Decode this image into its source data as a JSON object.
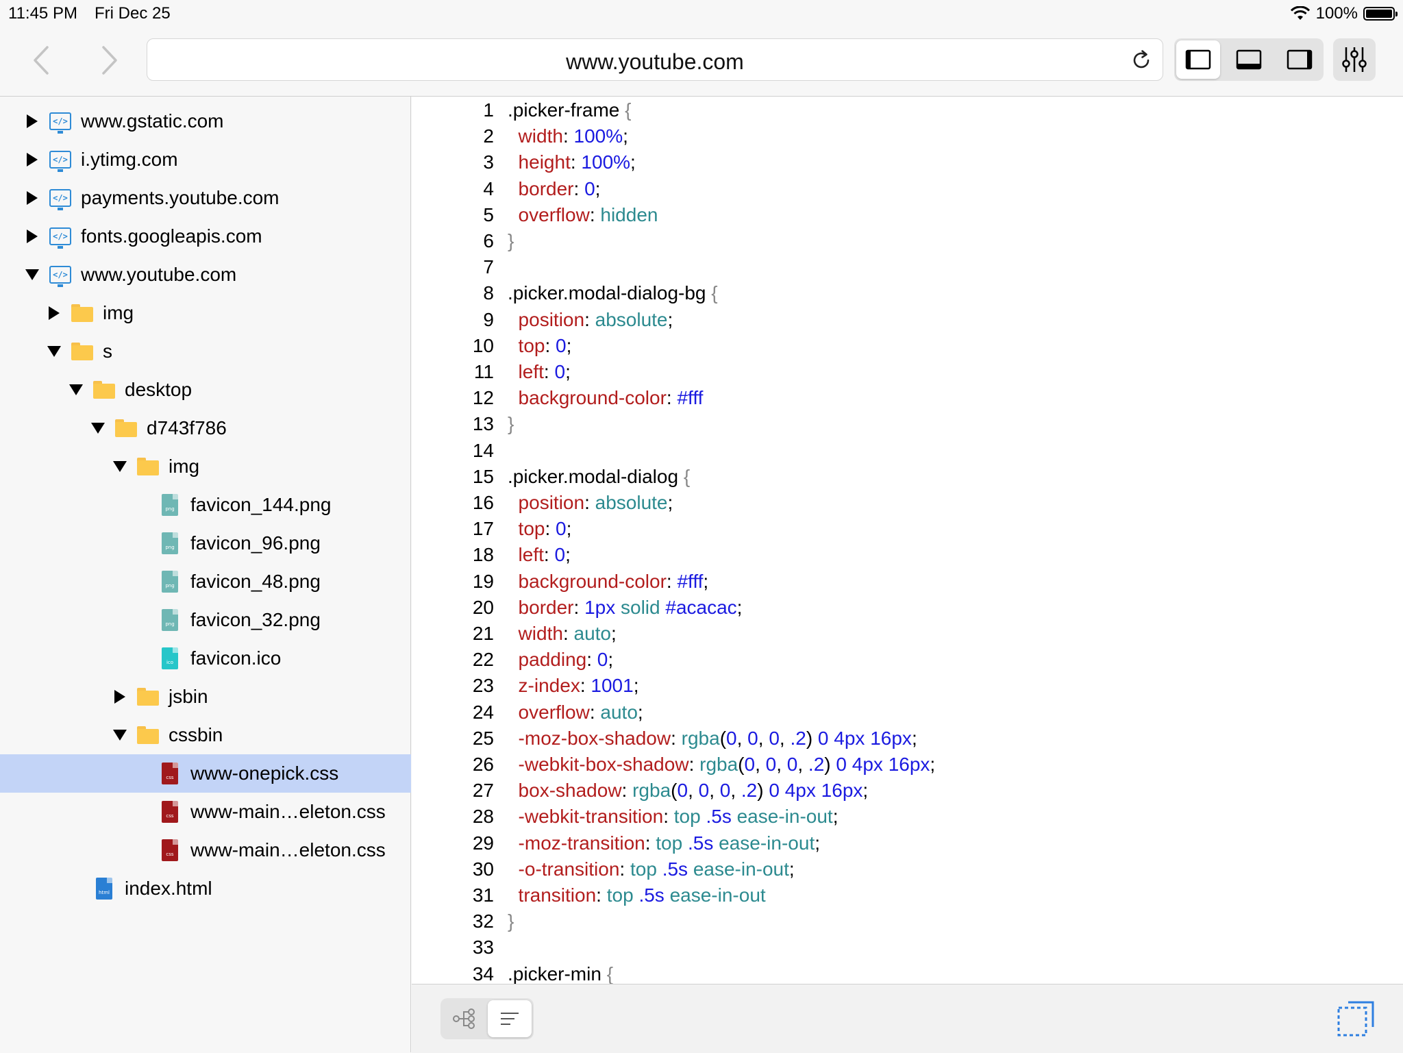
{
  "status": {
    "time": "11:45 PM",
    "date": "Fri Dec 25",
    "battery": "100%",
    "battery_level": 1.0
  },
  "toolbar": {
    "url": "www.youtube.com",
    "icons": {
      "back": "chevron-left-icon",
      "forward": "chevron-right-icon",
      "reload": "reload-icon",
      "settings": "sliders-icon"
    }
  },
  "tree": [
    {
      "label": "www.gstatic.com",
      "type": "domain",
      "depth": 0,
      "state": "collapsed"
    },
    {
      "label": "i.ytimg.com",
      "type": "domain",
      "depth": 0,
      "state": "collapsed"
    },
    {
      "label": "payments.youtube.com",
      "type": "domain",
      "depth": 0,
      "state": "collapsed"
    },
    {
      "label": "fonts.googleapis.com",
      "type": "domain",
      "depth": 0,
      "state": "collapsed"
    },
    {
      "label": "www.youtube.com",
      "type": "domain",
      "depth": 0,
      "state": "expanded"
    },
    {
      "label": "img",
      "type": "folder",
      "depth": 1,
      "state": "collapsed"
    },
    {
      "label": "s",
      "type": "folder",
      "depth": 1,
      "state": "expanded"
    },
    {
      "label": "desktop",
      "type": "folder",
      "depth": 2,
      "state": "expanded"
    },
    {
      "label": "d743f786",
      "type": "folder",
      "depth": 3,
      "state": "expanded"
    },
    {
      "label": "img",
      "type": "folder",
      "depth": 4,
      "state": "expanded"
    },
    {
      "label": "favicon_144.png",
      "type": "png",
      "depth": 5,
      "state": "none"
    },
    {
      "label": "favicon_96.png",
      "type": "png",
      "depth": 5,
      "state": "none"
    },
    {
      "label": "favicon_48.png",
      "type": "png",
      "depth": 5,
      "state": "none"
    },
    {
      "label": "favicon_32.png",
      "type": "png",
      "depth": 5,
      "state": "none"
    },
    {
      "label": "favicon.ico",
      "type": "ico",
      "depth": 5,
      "state": "none"
    },
    {
      "label": "jsbin",
      "type": "folder",
      "depth": 4,
      "state": "collapsed"
    },
    {
      "label": "cssbin",
      "type": "folder",
      "depth": 4,
      "state": "expanded"
    },
    {
      "label": "www-onepick.css",
      "type": "css",
      "depth": 5,
      "state": "none",
      "selected": true
    },
    {
      "label": "www-main…eleton.css",
      "type": "css",
      "depth": 5,
      "state": "none"
    },
    {
      "label": "www-main…eleton.css",
      "type": "css",
      "depth": 5,
      "state": "none"
    },
    {
      "label": "index.html",
      "type": "html",
      "depth": 2,
      "state": "none"
    }
  ],
  "file_icon_labels": {
    "png": "png",
    "ico": "ico",
    "css": "css",
    "html": "html"
  },
  "colors": {
    "png": "#6fb7b4",
    "ico": "#27c6c9",
    "css": "#a0191c",
    "html": "#2a7fd4",
    "selected_row": "#c3d4f7",
    "property": "#b21d1d",
    "number": "#1a1ae0",
    "keyword": "#2c8a8f"
  },
  "code": [
    [
      [
        "sel",
        ".picker-frame "
      ],
      [
        "brace",
        "{"
      ]
    ],
    [
      [
        "prop",
        "  width"
      ],
      [
        "pn",
        ": "
      ],
      [
        "num",
        "100%"
      ],
      [
        "pn",
        ";"
      ]
    ],
    [
      [
        "prop",
        "  height"
      ],
      [
        "pn",
        ": "
      ],
      [
        "num",
        "100%"
      ],
      [
        "pn",
        ";"
      ]
    ],
    [
      [
        "prop",
        "  border"
      ],
      [
        "pn",
        ": "
      ],
      [
        "num",
        "0"
      ],
      [
        "pn",
        ";"
      ]
    ],
    [
      [
        "prop",
        "  overflow"
      ],
      [
        "pn",
        ": "
      ],
      [
        "kw",
        "hidden"
      ]
    ],
    [
      [
        "brace",
        "}"
      ]
    ],
    [],
    [
      [
        "sel",
        ".picker.modal-dialog-bg "
      ],
      [
        "brace",
        "{"
      ]
    ],
    [
      [
        "prop",
        "  position"
      ],
      [
        "pn",
        ": "
      ],
      [
        "kw",
        "absolute"
      ],
      [
        "pn",
        ";"
      ]
    ],
    [
      [
        "prop",
        "  top"
      ],
      [
        "pn",
        ": "
      ],
      [
        "num",
        "0"
      ],
      [
        "pn",
        ";"
      ]
    ],
    [
      [
        "prop",
        "  left"
      ],
      [
        "pn",
        ": "
      ],
      [
        "num",
        "0"
      ],
      [
        "pn",
        ";"
      ]
    ],
    [
      [
        "prop",
        "  background-color"
      ],
      [
        "pn",
        ": "
      ],
      [
        "num",
        "#fff"
      ]
    ],
    [
      [
        "brace",
        "}"
      ]
    ],
    [],
    [
      [
        "sel",
        ".picker.modal-dialog "
      ],
      [
        "brace",
        "{"
      ]
    ],
    [
      [
        "prop",
        "  position"
      ],
      [
        "pn",
        ": "
      ],
      [
        "kw",
        "absolute"
      ],
      [
        "pn",
        ";"
      ]
    ],
    [
      [
        "prop",
        "  top"
      ],
      [
        "pn",
        ": "
      ],
      [
        "num",
        "0"
      ],
      [
        "pn",
        ";"
      ]
    ],
    [
      [
        "prop",
        "  left"
      ],
      [
        "pn",
        ": "
      ],
      [
        "num",
        "0"
      ],
      [
        "pn",
        ";"
      ]
    ],
    [
      [
        "prop",
        "  background-color"
      ],
      [
        "pn",
        ": "
      ],
      [
        "num",
        "#fff"
      ],
      [
        "pn",
        ";"
      ]
    ],
    [
      [
        "prop",
        "  border"
      ],
      [
        "pn",
        ": "
      ],
      [
        "num",
        "1px"
      ],
      [
        "pn",
        " "
      ],
      [
        "kw",
        "solid"
      ],
      [
        "pn",
        " "
      ],
      [
        "num",
        "#acacac"
      ],
      [
        "pn",
        ";"
      ]
    ],
    [
      [
        "prop",
        "  width"
      ],
      [
        "pn",
        ": "
      ],
      [
        "kw",
        "auto"
      ],
      [
        "pn",
        ";"
      ]
    ],
    [
      [
        "prop",
        "  padding"
      ],
      [
        "pn",
        ": "
      ],
      [
        "num",
        "0"
      ],
      [
        "pn",
        ";"
      ]
    ],
    [
      [
        "prop",
        "  z-index"
      ],
      [
        "pn",
        ": "
      ],
      [
        "num",
        "1001"
      ],
      [
        "pn",
        ";"
      ]
    ],
    [
      [
        "prop",
        "  overflow"
      ],
      [
        "pn",
        ": "
      ],
      [
        "kw",
        "auto"
      ],
      [
        "pn",
        ";"
      ]
    ],
    [
      [
        "prop",
        "  -moz-box-shadow"
      ],
      [
        "pn",
        ": "
      ],
      [
        "kw",
        "rgba"
      ],
      [
        "pn",
        "("
      ],
      [
        "num",
        "0"
      ],
      [
        "pn",
        ", "
      ],
      [
        "num",
        "0"
      ],
      [
        "pn",
        ", "
      ],
      [
        "num",
        "0"
      ],
      [
        "pn",
        ", "
      ],
      [
        "num",
        ".2"
      ],
      [
        "pn",
        ") "
      ],
      [
        "num",
        "0"
      ],
      [
        "pn",
        " "
      ],
      [
        "num",
        "4px"
      ],
      [
        "pn",
        " "
      ],
      [
        "num",
        "16px"
      ],
      [
        "pn",
        ";"
      ]
    ],
    [
      [
        "prop",
        "  -webkit-box-shadow"
      ],
      [
        "pn",
        ": "
      ],
      [
        "kw",
        "rgba"
      ],
      [
        "pn",
        "("
      ],
      [
        "num",
        "0"
      ],
      [
        "pn",
        ", "
      ],
      [
        "num",
        "0"
      ],
      [
        "pn",
        ", "
      ],
      [
        "num",
        "0"
      ],
      [
        "pn",
        ", "
      ],
      [
        "num",
        ".2"
      ],
      [
        "pn",
        ") "
      ],
      [
        "num",
        "0"
      ],
      [
        "pn",
        " "
      ],
      [
        "num",
        "4px"
      ],
      [
        "pn",
        " "
      ],
      [
        "num",
        "16px"
      ],
      [
        "pn",
        ";"
      ]
    ],
    [
      [
        "prop",
        "  box-shadow"
      ],
      [
        "pn",
        ": "
      ],
      [
        "kw",
        "rgba"
      ],
      [
        "pn",
        "("
      ],
      [
        "num",
        "0"
      ],
      [
        "pn",
        ", "
      ],
      [
        "num",
        "0"
      ],
      [
        "pn",
        ", "
      ],
      [
        "num",
        "0"
      ],
      [
        "pn",
        ", "
      ],
      [
        "num",
        ".2"
      ],
      [
        "pn",
        ") "
      ],
      [
        "num",
        "0"
      ],
      [
        "pn",
        " "
      ],
      [
        "num",
        "4px"
      ],
      [
        "pn",
        " "
      ],
      [
        "num",
        "16px"
      ],
      [
        "pn",
        ";"
      ]
    ],
    [
      [
        "prop",
        "  -webkit-transition"
      ],
      [
        "pn",
        ": "
      ],
      [
        "kw",
        "top"
      ],
      [
        "pn",
        " "
      ],
      [
        "num",
        ".5s"
      ],
      [
        "pn",
        " "
      ],
      [
        "kw",
        "ease-in-out"
      ],
      [
        "pn",
        ";"
      ]
    ],
    [
      [
        "prop",
        "  -moz-transition"
      ],
      [
        "pn",
        ": "
      ],
      [
        "kw",
        "top"
      ],
      [
        "pn",
        " "
      ],
      [
        "num",
        ".5s"
      ],
      [
        "pn",
        " "
      ],
      [
        "kw",
        "ease-in-out"
      ],
      [
        "pn",
        ";"
      ]
    ],
    [
      [
        "prop",
        "  -o-transition"
      ],
      [
        "pn",
        ": "
      ],
      [
        "kw",
        "top"
      ],
      [
        "pn",
        " "
      ],
      [
        "num",
        ".5s"
      ],
      [
        "pn",
        " "
      ],
      [
        "kw",
        "ease-in-out"
      ],
      [
        "pn",
        ";"
      ]
    ],
    [
      [
        "prop",
        "  transition"
      ],
      [
        "pn",
        ": "
      ],
      [
        "kw",
        "top"
      ],
      [
        "pn",
        " "
      ],
      [
        "num",
        ".5s"
      ],
      [
        "pn",
        " "
      ],
      [
        "kw",
        "ease-in-out"
      ]
    ],
    [
      [
        "brace",
        "}"
      ]
    ],
    [],
    [
      [
        "sel",
        ".picker-min "
      ],
      [
        "brace",
        "{"
      ]
    ]
  ]
}
